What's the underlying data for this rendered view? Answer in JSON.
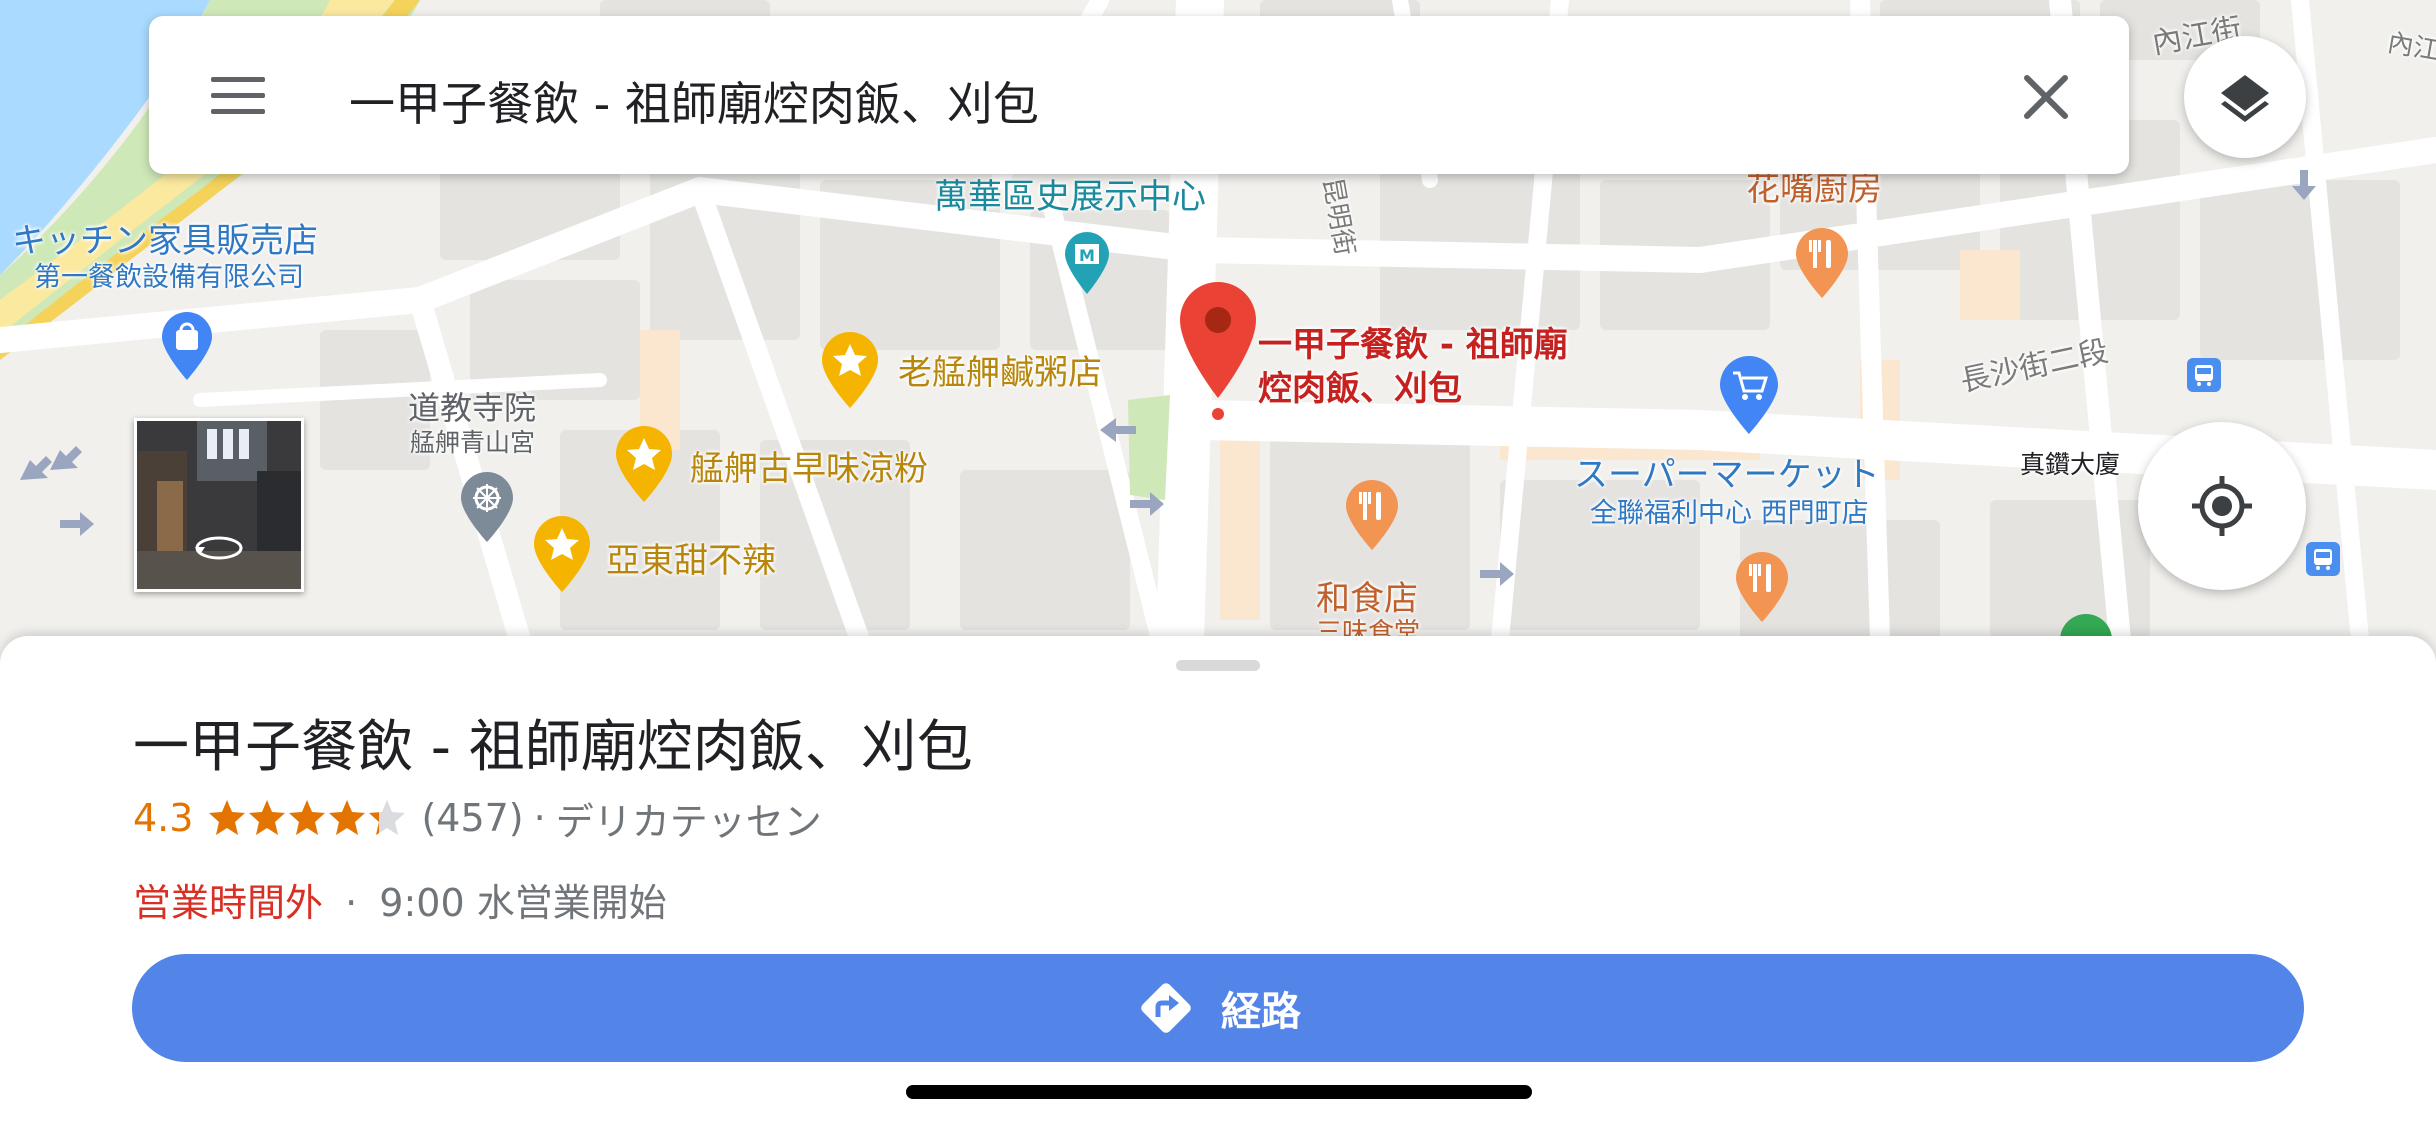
{
  "search": {
    "query": "一甲子餐飲 - 祖師廟焢肉飯、刈包",
    "menu_icon": "hamburger-menu-icon",
    "clear_icon": "close-icon"
  },
  "map": {
    "landmarks": [
      {
        "name": "萬華區史展示中心",
        "type": "museum",
        "icon": "museum-icon",
        "color": "#1a8a9e"
      },
      {
        "name": "キッチン家具販売店",
        "type": "shopping",
        "icon": "shopping-bag-icon",
        "color": "#2f78c4"
      },
      {
        "name": "第一餐飲設備有限公司",
        "type": "shopping-subtitle",
        "color": "#2f78c4"
      },
      {
        "name": "花嘴廚房",
        "type": "restaurant",
        "icon": "fork-knife-icon",
        "color": "#c0602c"
      },
      {
        "name": "老艋舺鹹粥店",
        "type": "favorite",
        "icon": "star-icon",
        "color": "#b8860b"
      },
      {
        "name": "道教寺院",
        "type": "temple",
        "icon": "dharma-wheel-icon",
        "color": "#5f6368"
      },
      {
        "name": "艋舺青山宮",
        "type": "temple-subtitle",
        "color": "#5f6368"
      },
      {
        "name": "艋舺古早味涼粉",
        "type": "favorite",
        "icon": "star-icon",
        "color": "#b8860b"
      },
      {
        "name": "亞東甜不辣",
        "type": "favorite",
        "icon": "star-icon",
        "color": "#b8860b"
      },
      {
        "name": "スーパーマーケット",
        "type": "supermarket",
        "icon": "shopping-cart-icon",
        "color": "#2f78c4"
      },
      {
        "name": "全聯福利中心 西門町店",
        "type": "supermarket-subtitle",
        "color": "#2f78c4"
      },
      {
        "name": "和食店",
        "type": "restaurant",
        "icon": "fork-knife-icon",
        "color": "#c0602c"
      },
      {
        "name": "三味食堂",
        "type": "restaurant-subtitle",
        "color": "#c0602c"
      },
      {
        "name": "真鑽大廈",
        "type": "building",
        "color": "#202124"
      }
    ],
    "roads": [
      "長沙街二段",
      "內江街",
      "昆明街",
      "內江街"
    ],
    "selected_pin": {
      "label": "一甲子餐飲 - 祖師廟焢肉飯、刈包",
      "line1": "一甲子餐飲 - 祖師廟",
      "line2": "焢肉飯、刈包",
      "color": "#c5221f"
    },
    "layers_icon": "layers-icon",
    "locate_icon": "my-location-icon",
    "street_view_icon": "street-view-360-icon",
    "bus_icon": "bus-stop-icon"
  },
  "place": {
    "name": "一甲子餐飲 - 祖師廟焢肉飯、刈包",
    "rating": 4.3,
    "rating_text": "4.3",
    "review_count": "(457)",
    "separator": "·",
    "category": "デリカテッセン",
    "hours_status": "営業時間外",
    "hours_next": "9:00 水営業開始",
    "directions_label": "経路",
    "directions_icon": "directions-icon"
  },
  "colors": {
    "accent_blue": "#5384e8",
    "rating_orange": "#e37400",
    "closed_red": "#d93025",
    "water": "#aadaff"
  }
}
